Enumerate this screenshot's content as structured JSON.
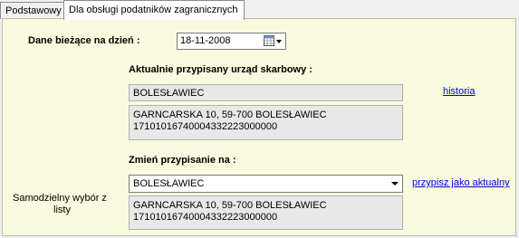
{
  "tabs": [
    {
      "label": "Podstawowy"
    },
    {
      "label": "Dla obsługi podatników zagranicznych"
    }
  ],
  "form": {
    "current_date_label": "Dane bieżące na dzień :",
    "current_date_value": "18-11-2008",
    "assigned_office_heading": "Aktualnie przypisany urząd skarbowy :",
    "assigned_office_name": "BOLESŁAWIEC",
    "assigned_office_address": "GARNCARSKA 10, 59-700 BOLESŁAWIEC",
    "assigned_office_account": "17101016740004332223000000",
    "history_link": "historia",
    "change_heading": "Zmień przypisanie na :",
    "change_selected": "BOLESŁAWIEC",
    "change_address": "GARNCARSKA 10, 59-700 BOLESŁAWIEC",
    "change_account": "17101016740004332223000000",
    "assign_link": "przypisz jako aktualny",
    "manual_choice_label_line1": "Samodzielny wybór z",
    "manual_choice_label_line2": "listy"
  },
  "icons": {
    "date_picker": "calendar-icon",
    "dropdown": "chevron-down-icon"
  }
}
